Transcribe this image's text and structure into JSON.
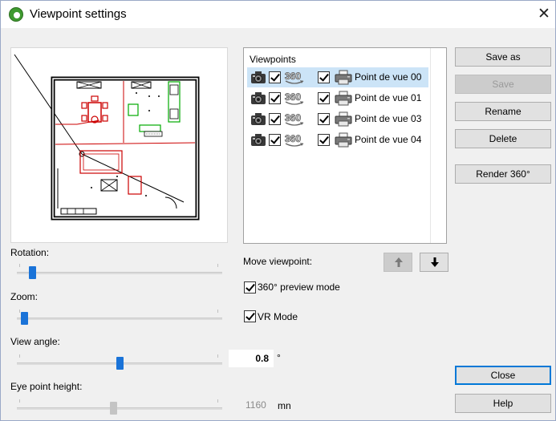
{
  "window": {
    "title": "Viewpoint settings",
    "close_symbol": "✕"
  },
  "sliders": {
    "rotation": {
      "label": "Rotation:",
      "level": 0.06
    },
    "zoom": {
      "label": "Zoom:",
      "level": 0.02
    },
    "view_angle": {
      "label": "View angle:",
      "level": 0.5,
      "value": "0.8",
      "unit": "°"
    },
    "eye_point_height": {
      "label": "Eye point height:",
      "level": 0.47,
      "value": "1160",
      "unit": "mn",
      "enabled": false
    }
  },
  "viewpoints": {
    "header": "Viewpoints",
    "items": [
      {
        "name": "Point de vue 00",
        "selected": true
      },
      {
        "name": "Point de vue 01",
        "selected": false
      },
      {
        "name": "Point de vue 03",
        "selected": false
      },
      {
        "name": "Point de vue 04",
        "selected": false
      }
    ],
    "icons": [
      "camera-icon",
      "360-icon",
      "printer-icon"
    ]
  },
  "move": {
    "label": "Move viewpoint:",
    "up_icon": "arrow-up-icon",
    "down_icon": "arrow-down-icon"
  },
  "options": {
    "preview_360": {
      "label": "360° preview mode",
      "checked": true
    },
    "vr_mode": {
      "label": "VR Mode",
      "checked": true
    }
  },
  "buttons": {
    "save_as": "Save as",
    "save": "Save",
    "rename": "Rename",
    "delete": "Delete",
    "render_360": "Render 360°",
    "close": "Close",
    "help": "Help"
  },
  "colors": {
    "accent": "#1a73d8",
    "selection": "#cce4f7",
    "app_icon": "#3f9a2f"
  }
}
